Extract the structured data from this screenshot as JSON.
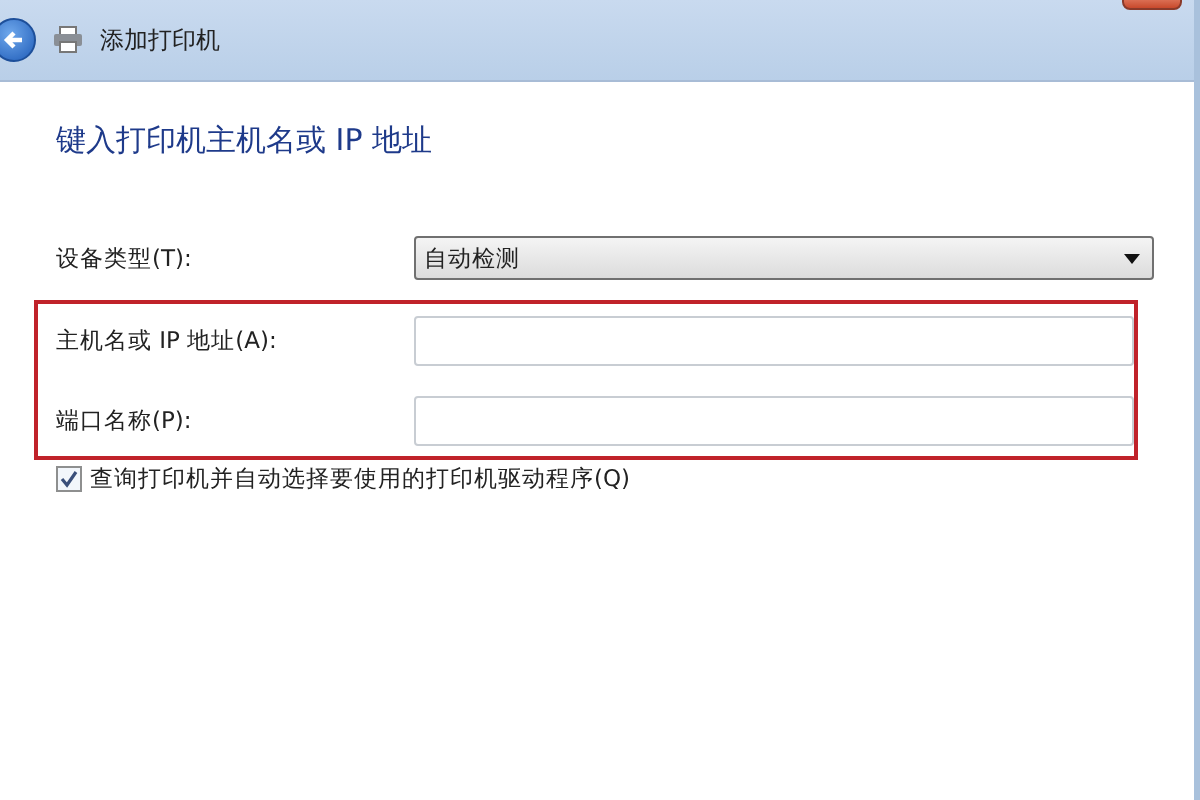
{
  "window": {
    "title": "添加打印机"
  },
  "heading": "键入打印机主机名或 IP 地址",
  "device_type": {
    "label": "设备类型(T):",
    "value": "自动检测"
  },
  "highlighted_fields": [
    {
      "label": "主机名或 IP 地址(A):"
    },
    {
      "label": "端口名称(P):"
    }
  ],
  "query_checkbox": {
    "label": "查询打印机并自动选择要使用的打印机驱动程序(Q)",
    "checked": true
  }
}
